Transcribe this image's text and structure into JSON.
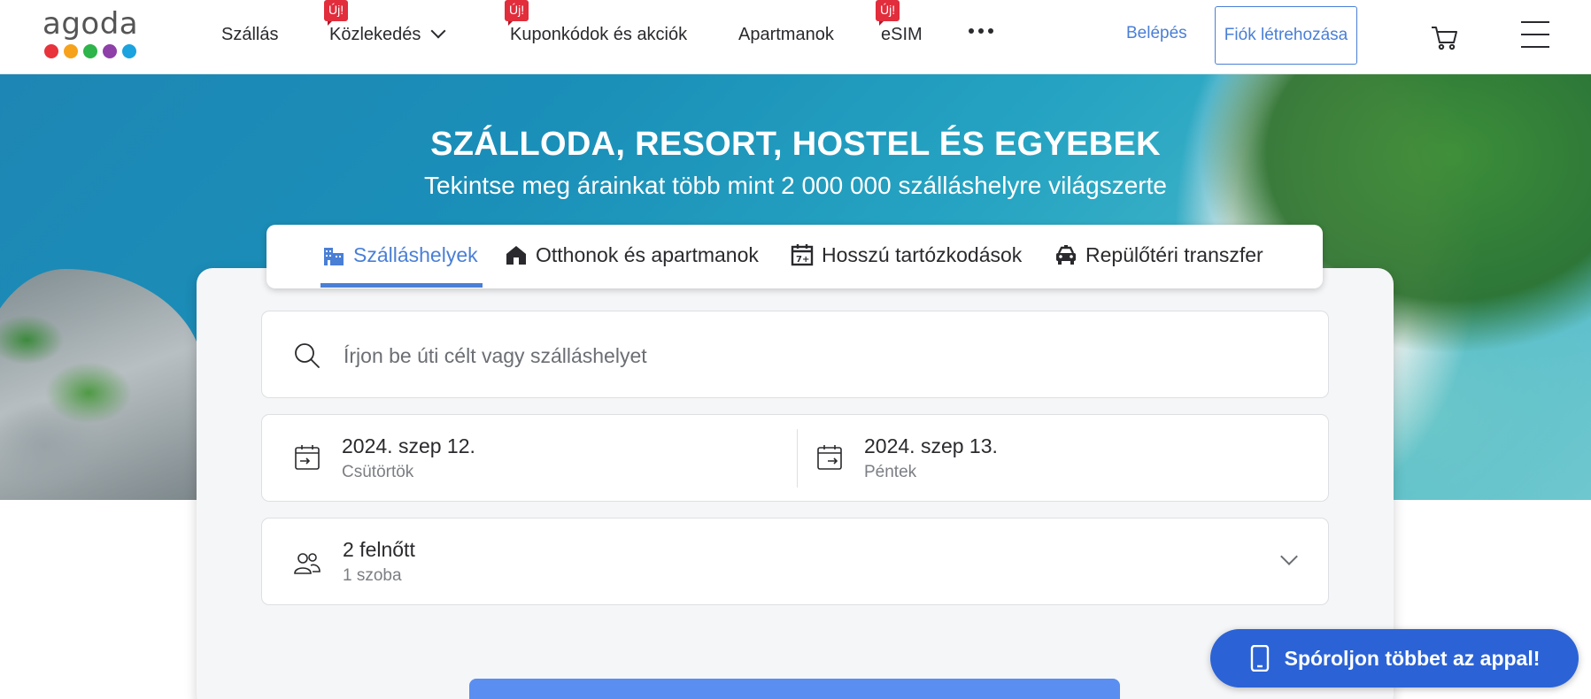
{
  "logo": {
    "text": "agoda",
    "dot_colors": [
      "#e8323c",
      "#f7a21b",
      "#2db44a",
      "#8e3fa8",
      "#1aa3de"
    ]
  },
  "nav": {
    "items": [
      {
        "label": "Szállás",
        "badge": ""
      },
      {
        "label": "Közlekedés",
        "badge": "Új!"
      },
      {
        "label": "Kuponkódok és akciók",
        "badge": "Új!"
      },
      {
        "label": "Apartmanok",
        "badge": ""
      },
      {
        "label": "eSIM",
        "badge": "Új!"
      }
    ],
    "more_icon": "more-dots-icon",
    "login": "Belépés",
    "signup": "Fiók létrehozása",
    "cart_icon": "cart-icon",
    "menu_icon": "hamburger-menu-icon"
  },
  "hero": {
    "title": "SZÁLLODA, RESORT, HOSTEL ÉS EGYEBEK",
    "subtitle": "Tekintse meg árainkat több mint 2 000 000 szálláshelyre világszerte"
  },
  "tabs": [
    {
      "label": "Szálláshelyek",
      "icon": "hotel-building-icon",
      "active": true
    },
    {
      "label": "Otthonok és apartmanok",
      "icon": "house-icon",
      "active": false
    },
    {
      "label": "Hosszú tartózkodások",
      "icon": "calendar-7plus-icon",
      "active": false
    },
    {
      "label": "Repülőtéri transzfer",
      "icon": "car-icon",
      "active": false
    }
  ],
  "search": {
    "placeholder": "Írjon be úti célt vagy szálláshelyet"
  },
  "dates": {
    "checkin": {
      "date": "2024. szep 12.",
      "day": "Csütörtök"
    },
    "checkout": {
      "date": "2024. szep 13.",
      "day": "Péntek"
    }
  },
  "guests": {
    "adults": "2 felnőtt",
    "rooms": "1 szoba"
  },
  "app_promo": {
    "label": "Spóroljon többet az appal!"
  },
  "colors": {
    "accent": "#4a7fd6",
    "badge": "#e12d3c",
    "app_button": "#2b63d6"
  }
}
